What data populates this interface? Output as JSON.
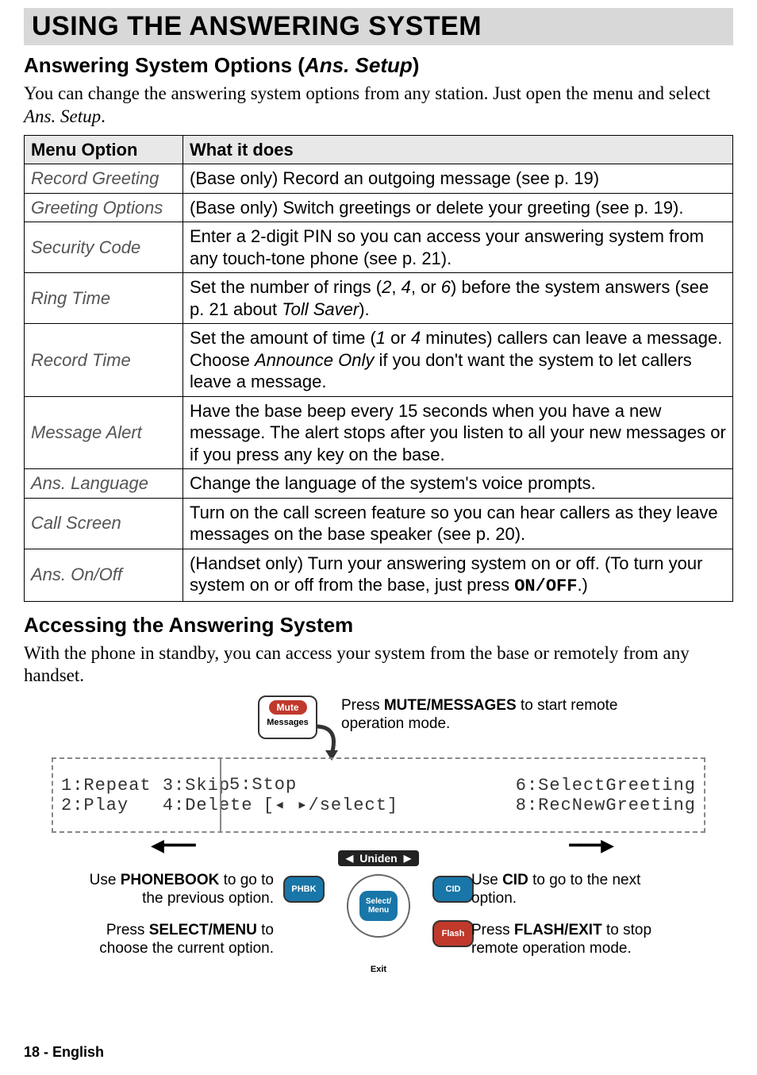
{
  "title": "USING THE ANSWERING SYSTEM",
  "section1": {
    "heading_prefix": "Answering System Options (",
    "heading_italic": "Ans. Setup",
    "heading_suffix": ")",
    "intro_a": "You can change the answering system options from any station. Just open the menu and select ",
    "intro_b": "Ans. Setup",
    "intro_c": "."
  },
  "table": {
    "head_option": "Menu Option",
    "head_desc": "What it does",
    "rows": [
      {
        "option": "Record Greeting",
        "desc_plain": "(Base only) Record an outgoing message (see p. 19)"
      },
      {
        "option": "Greeting Options",
        "desc_plain": "(Base only) Switch greetings or delete your greeting (see p. 19)."
      },
      {
        "option": "Security Code",
        "desc_plain": "Enter a 2-digit PIN so you can access your answering system from any touch-tone phone (see p. 21)."
      },
      {
        "option": "Ring Time",
        "parts": [
          "Set the number of rings (",
          "2",
          ", ",
          "4",
          ", or ",
          "6",
          ") before the system answers (see p. 21 about ",
          "Toll Saver",
          ")."
        ],
        "italics": [
          false,
          true,
          false,
          true,
          false,
          true,
          false,
          true,
          false
        ]
      },
      {
        "option": "Record Time",
        "parts": [
          "Set the amount of time (",
          "1",
          " or ",
          "4",
          " minutes) callers can leave a message. Choose ",
          "Announce Only",
          " if you don't want the system to let callers leave a message."
        ],
        "italics": [
          false,
          true,
          false,
          true,
          false,
          true,
          false
        ]
      },
      {
        "option": "Message Alert",
        "desc_plain": "Have the base beep every 15 seconds when you have a new message. The alert stops after you listen to all your new messages or if you press any key on the base."
      },
      {
        "option": "Ans. Language",
        "desc_plain": "Change the language of the system's voice prompts."
      },
      {
        "option": "Call Screen",
        "desc_plain": "Turn on the call screen feature so you can hear callers as they leave messages on the base speaker (see p. 20)."
      },
      {
        "option": "Ans. On/Off",
        "parts": [
          "(Handset only) Turn your answering system on or off. (To turn your system on or off from the base, just press ",
          "ON/OFF",
          ".)"
        ],
        "code_idx": 1
      }
    ]
  },
  "section2": {
    "heading": "Accessing the Answering System",
    "intro": "With the phone in standby, you can access your system from the base or remotely from any handset."
  },
  "diagram": {
    "mute_pill": "Mute",
    "mute_lbl": "Messages",
    "mute_text_a": "Press ",
    "mute_text_b": "MUTE/MESSAGES",
    "mute_text_c": " to start remote operation mode.",
    "lcd": {
      "c1l1": "1:Repeat 3:Skip",
      "c1l2": "2:Play   4:Delete",
      "c2l1": "5:Stop",
      "c2l2": "   [◂ ▸/select]",
      "c3l1": "6:SelectGreeting",
      "c3l2": "8:RecNewGreeting"
    },
    "uniden": "Uniden",
    "btn_phbk": "PHBK",
    "btn_cid": "CID",
    "btn_flash": "Flash",
    "btn_select1": "Select/",
    "btn_select2": "Menu",
    "exit": "Exit",
    "cap_phbk_a": "Use ",
    "cap_phbk_b": "PHONEBOOK",
    "cap_phbk_c": " to go to the previous option.",
    "cap_select_a": "Press ",
    "cap_select_b": "SELECT/MENU",
    "cap_select_c": " to choose the current option.",
    "cap_cid_a": "Use ",
    "cap_cid_b": "CID",
    "cap_cid_c": " to go to the next option.",
    "cap_flash_a": "Press ",
    "cap_flash_b": "FLASH/EXIT",
    "cap_flash_c": " to stop remote operation mode."
  },
  "footer": {
    "page": "18",
    "sep": " - ",
    "lang": "English"
  }
}
